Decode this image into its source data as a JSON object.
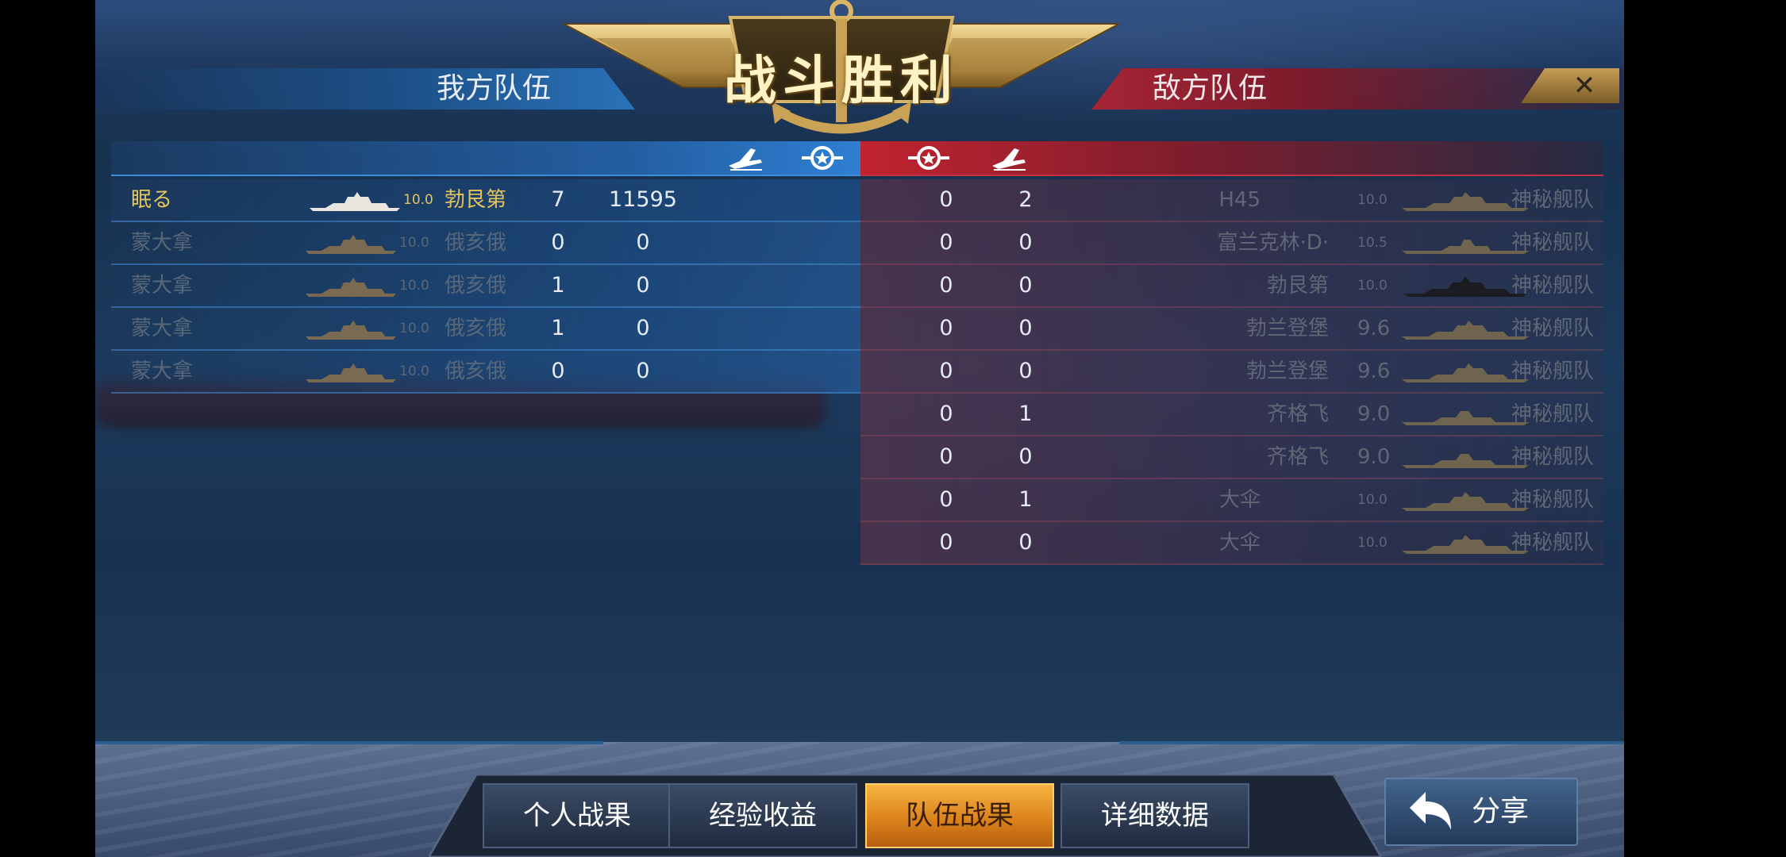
{
  "header": {
    "title": "战斗胜利",
    "left_team": "我方队伍",
    "right_team": "敌方队伍",
    "close_symbol": "✕"
  },
  "column_icons": {
    "left": [
      "plane-kill-icon",
      "damage-medal-icon"
    ],
    "right": [
      "damage-medal-icon",
      "plane-kill-icon"
    ]
  },
  "my_team": [
    {
      "player": "眠る",
      "tier": "10.0",
      "ship": "勃艮第",
      "kills": "7",
      "damage": "11595",
      "highlight": true
    },
    {
      "player": "蒙大拿",
      "tier": "10.0",
      "ship": "俄亥俄",
      "kills": "0",
      "damage": "0",
      "highlight": false
    },
    {
      "player": "蒙大拿",
      "tier": "10.0",
      "ship": "俄亥俄",
      "kills": "1",
      "damage": "0",
      "highlight": false
    },
    {
      "player": "蒙大拿",
      "tier": "10.0",
      "ship": "俄亥俄",
      "kills": "1",
      "damage": "0",
      "highlight": false
    },
    {
      "player": "蒙大拿",
      "tier": "10.0",
      "ship": "俄亥俄",
      "kills": "0",
      "damage": "0",
      "highlight": false
    }
  ],
  "enemy_team": [
    {
      "damage": "0",
      "kills": "2",
      "ship": "H45",
      "tier": "10.0",
      "player": "神秘舰队",
      "tier_small": true
    },
    {
      "damage": "0",
      "kills": "0",
      "ship": "富兰克林·D·",
      "tier": "10.5",
      "player": "神秘舰队",
      "tier_small": true
    },
    {
      "damage": "0",
      "kills": "0",
      "ship": "勃艮第",
      "tier": "10.0",
      "player": "神秘舰队",
      "tier_small": true
    },
    {
      "damage": "0",
      "kills": "0",
      "ship": "勃兰登堡",
      "tier": "9.6",
      "player": "神秘舰队",
      "tier_small": false
    },
    {
      "damage": "0",
      "kills": "0",
      "ship": "勃兰登堡",
      "tier": "9.6",
      "player": "神秘舰队",
      "tier_small": false
    },
    {
      "damage": "0",
      "kills": "1",
      "ship": "齐格飞",
      "tier": "9.0",
      "player": "神秘舰队",
      "tier_small": false
    },
    {
      "damage": "0",
      "kills": "0",
      "ship": "齐格飞",
      "tier": "9.0",
      "player": "神秘舰队",
      "tier_small": false
    },
    {
      "damage": "0",
      "kills": "1",
      "ship": "大伞",
      "tier": "10.0",
      "player": "神秘舰队",
      "tier_small": true
    },
    {
      "damage": "0",
      "kills": "0",
      "ship": "大伞",
      "tier": "10.0",
      "player": "神秘舰队",
      "tier_small": true
    }
  ],
  "tabs": [
    {
      "label": "个人战果",
      "active": false
    },
    {
      "label": "经验收益",
      "active": false
    },
    {
      "label": "队伍战果",
      "active": true
    },
    {
      "label": "详细数据",
      "active": false
    }
  ],
  "share": {
    "label": "分享",
    "icon": "back-arrow-icon"
  },
  "colors": {
    "gold": "#e4c45b",
    "accent_blue": "#2f7fd3",
    "accent_red": "#c1232f",
    "active_tab": "#f6b441"
  }
}
